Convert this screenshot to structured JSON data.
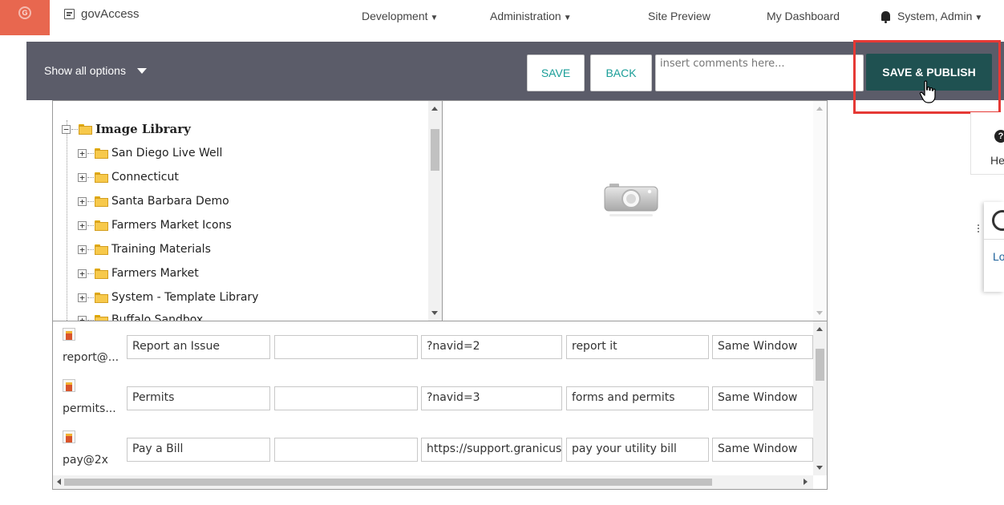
{
  "topnav": {
    "product_name": "govAccess",
    "brand_color": "#e8674f",
    "menu": [
      {
        "label": "Development",
        "has_dropdown": true
      },
      {
        "label": "Administration",
        "has_dropdown": true
      },
      {
        "label": "Site Preview",
        "has_dropdown": false
      },
      {
        "label": "My Dashboard",
        "has_dropdown": false
      }
    ],
    "user": {
      "label": "System, Admin",
      "icon": "bell-icon"
    }
  },
  "toolbar": {
    "show_options_label": "Show all options",
    "save_label": "SAVE",
    "back_label": "BACK",
    "comments_placeholder": "insert comments here...",
    "publish_label": "SAVE & PUBLISH",
    "background": "#5b5c69",
    "publish_color": "#1f5151",
    "accent": "#1a9e98",
    "highlight_color": "#e53935"
  },
  "sidepanel": {
    "help_fragment": "He",
    "link_fragment": "Lo"
  },
  "tree": {
    "root": "Image Library",
    "items": [
      "San Diego Live Well",
      "Connecticut",
      "Santa Barbara Demo",
      "Farmers Market Icons",
      "Training Materials",
      "Farmers Market",
      "System - Template Library",
      "Buffalo Sandbox"
    ]
  },
  "preview": {
    "icon": "camera-icon"
  },
  "grid": {
    "rows": [
      {
        "name": "report@...",
        "title": "Report an Issue",
        "extra": "",
        "link": "?navid=2",
        "description": "report it",
        "target": "Same Window"
      },
      {
        "name": "permits...",
        "title": "Permits",
        "extra": "",
        "link": "?navid=3",
        "description": "forms and permits",
        "target": "Same Window"
      },
      {
        "name": "pay@2x",
        "title": "Pay a Bill",
        "extra": "",
        "link": "https://support.granicus.com",
        "description": "pay your utility bill",
        "target": "Same Window"
      }
    ]
  }
}
